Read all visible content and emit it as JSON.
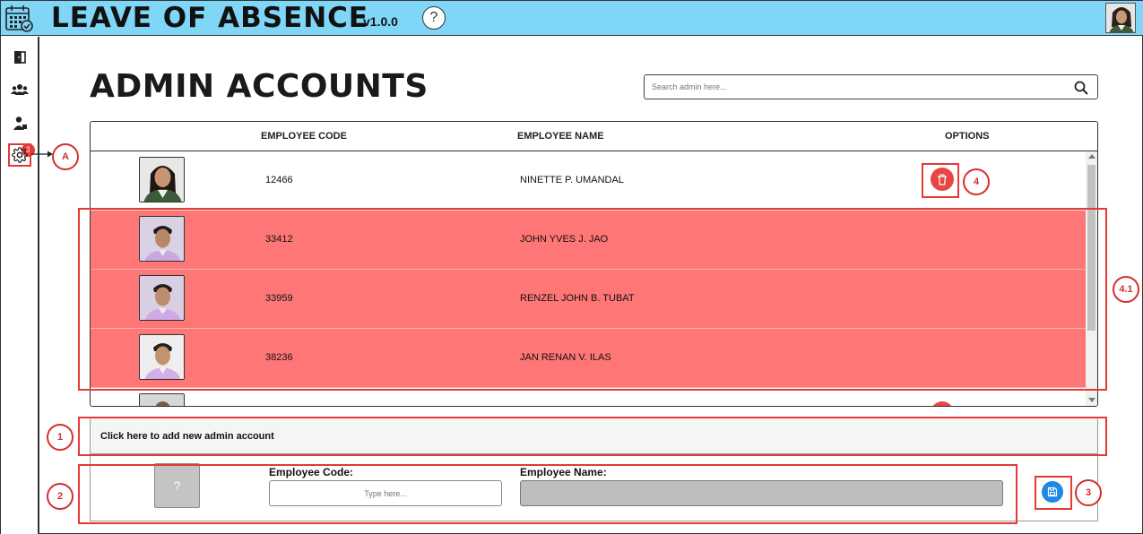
{
  "header": {
    "title": "LEAVE OF ABSENCE",
    "version": "v1.0.0",
    "help_label": "?",
    "logo_icon": "calendar-icon",
    "avatar_icon": "user-avatar"
  },
  "sidebar": {
    "items": [
      {
        "icon": "door-icon",
        "label": ""
      },
      {
        "icon": "users-icon",
        "label": ""
      },
      {
        "icon": "user-requests-icon",
        "badge": "3"
      },
      {
        "icon": "gear-icon",
        "label": ""
      }
    ]
  },
  "page": {
    "title": "ADMIN ACCOUNTS",
    "search_placeholder": "Search admin here..."
  },
  "table": {
    "columns": [
      "EMPLOYEE CODE",
      "EMPLOYEE NAME",
      "OPTIONS"
    ],
    "rows": [
      {
        "code": "12466",
        "name": "NINETTE P. UMANDAL",
        "selected": false
      },
      {
        "code": "33412",
        "name": "JOHN YVES J. JAO",
        "selected": true
      },
      {
        "code": "33959",
        "name": "RENZEL JOHN B. TUBAT",
        "selected": true
      },
      {
        "code": "38236",
        "name": "JAN RENAN V. ILAS",
        "selected": true
      }
    ]
  },
  "add_admin": {
    "bar_label": "Click here to add new admin account",
    "photo_placeholder": "?",
    "code_label": "Employee Code:",
    "code_placeholder": "Type here...",
    "name_label": "Employee Name:",
    "name_value": ""
  },
  "annotations": {
    "a": "A",
    "n1": "1",
    "n2": "2",
    "n3": "3",
    "n4": "4",
    "n41": "4.1"
  },
  "colors": {
    "topbar": "#7fd6f7",
    "selected_row": "#ff7676",
    "delete": "#e84545",
    "save": "#1e88e5",
    "annotation": "#e53935"
  }
}
